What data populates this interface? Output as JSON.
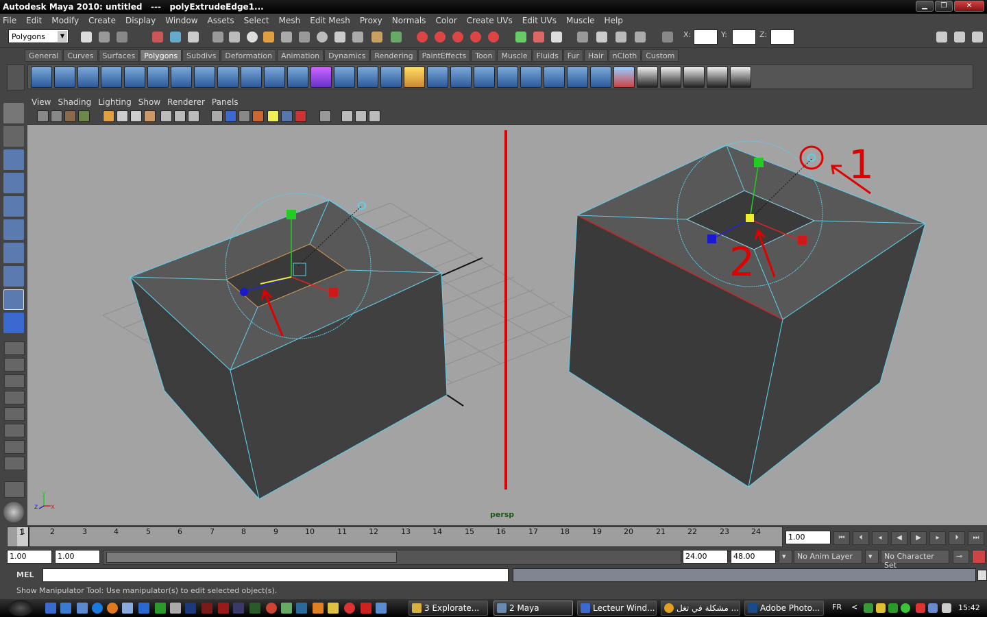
{
  "window": {
    "title_app": "Autodesk Maya 2010: untitled",
    "title_sep": "---",
    "title_node": "polyExtrudeEdge1...",
    "min_label": "▁",
    "max_label": "❐",
    "close_label": "✕"
  },
  "menu": [
    "File",
    "Edit",
    "Modify",
    "Create",
    "Display",
    "Window",
    "Assets",
    "Select",
    "Mesh",
    "Edit Mesh",
    "Proxy",
    "Normals",
    "Color",
    "Create UVs",
    "Edit UVs",
    "Muscle",
    "Help"
  ],
  "statusline": {
    "mode": "Polygons",
    "x_label": "X:",
    "y_label": "Y:",
    "z_label": "Z:"
  },
  "shelf": {
    "tabs": [
      "General",
      "Curves",
      "Surfaces",
      "Polygons",
      "Subdivs",
      "Deformation",
      "Animation",
      "Dynamics",
      "Rendering",
      "PaintEffects",
      "Toon",
      "Muscle",
      "Fluids",
      "Fur",
      "Hair",
      "nCloth",
      "Custom"
    ],
    "active_tab": "Polygons"
  },
  "panel": {
    "menu": [
      "View",
      "Shading",
      "Lighting",
      "Show",
      "Renderer",
      "Panels"
    ],
    "camera": "persp"
  },
  "annotations": {
    "label_1": "1",
    "label_2": "2",
    "color": "#e00000"
  },
  "axis": {
    "x": "x",
    "y": "y",
    "z": "z"
  },
  "timeline": {
    "current_frame": "1",
    "ticks": [
      "1",
      "2",
      "3",
      "4",
      "5",
      "6",
      "7",
      "8",
      "9",
      "10",
      "11",
      "12",
      "13",
      "14",
      "15",
      "16",
      "17",
      "18",
      "19",
      "20",
      "21",
      "22",
      "23",
      "24"
    ],
    "current_time": "1.00",
    "start_time": "1.00",
    "playback_start": "1.00",
    "playback_end": "24.00",
    "end_time": "48.00",
    "anim_layer": "No Anim Layer",
    "character_set": "No Character Set"
  },
  "commandline": {
    "label": "MEL",
    "help": "Show Manipulator Tool: Use manipulator(s) to edit selected object(s)."
  },
  "taskbar": {
    "buttons": [
      {
        "label": "3 Explorate...",
        "color": "#d8b040"
      },
      {
        "label": "2 Maya",
        "color": "#6a8ab0"
      },
      {
        "label": "Lecteur Wind...",
        "color": "#3a6ad0"
      },
      {
        "label": "مشكلة في تغل ...",
        "color": "#e0a020"
      },
      {
        "label": "Adobe Photo...",
        "color": "#1a4a8a"
      }
    ],
    "language": "FR",
    "time": "15:42"
  },
  "colors": {
    "viewport_bg": "#a3a3a3",
    "mesh_face": "#3e3e3e",
    "mesh_top": "#585858",
    "wire_highlight": "#5fd0ea"
  }
}
